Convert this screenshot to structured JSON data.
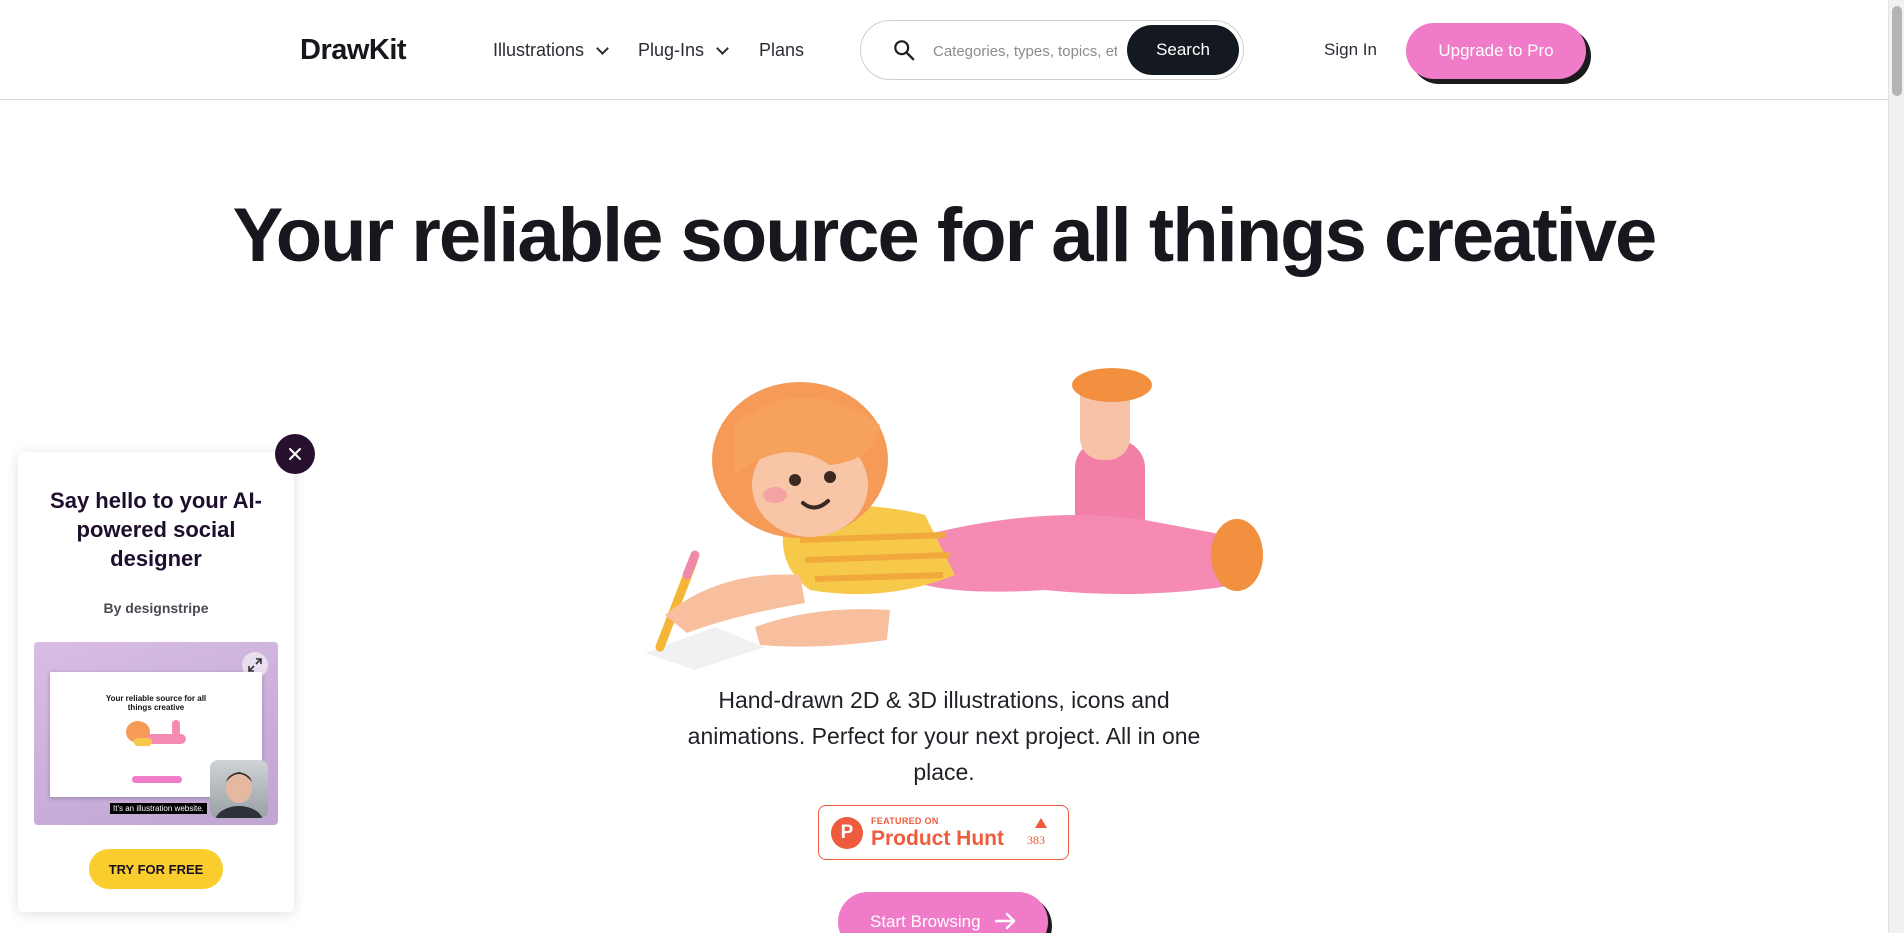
{
  "header": {
    "logo": "DrawKit",
    "nav": [
      {
        "label": "Illustrations",
        "has_dropdown": true
      },
      {
        "label": "Plug-Ins",
        "has_dropdown": true
      },
      {
        "label": "Plans",
        "has_dropdown": false
      }
    ],
    "search": {
      "placeholder": "Categories, types, topics, etc",
      "value": "",
      "button_label": "Search"
    },
    "sign_in": "Sign In",
    "upgrade": "Upgrade to Pro"
  },
  "hero": {
    "title": "Your reliable source for all things creative",
    "subtitle": "Hand-drawn 2D & 3D illustrations, icons and animations. Perfect for your next project. All in one place.",
    "product_hunt": {
      "featured": "FEATURED ON",
      "name": "Product Hunt",
      "letter": "P",
      "count": "383"
    },
    "cta": "Start Browsing"
  },
  "popup": {
    "title": "Say hello to your AI-powered social designer",
    "byline": "By designstripe",
    "preview_title": "Your reliable source for all things creative",
    "caption": "It's an illustration website.",
    "cta": "TRY FOR FREE"
  },
  "colors": {
    "accent_pink": "#ef7bc9",
    "dark": "#141820",
    "product_hunt": "#ef5b3d",
    "popup_yellow": "#f9cd2d",
    "popup_close": "#26102d"
  },
  "icons": {
    "search": "magnifier-icon",
    "dropdown": "chevron-down-icon",
    "close": "close-icon",
    "expand": "expand-icon",
    "arrow": "arrow-right-icon"
  }
}
